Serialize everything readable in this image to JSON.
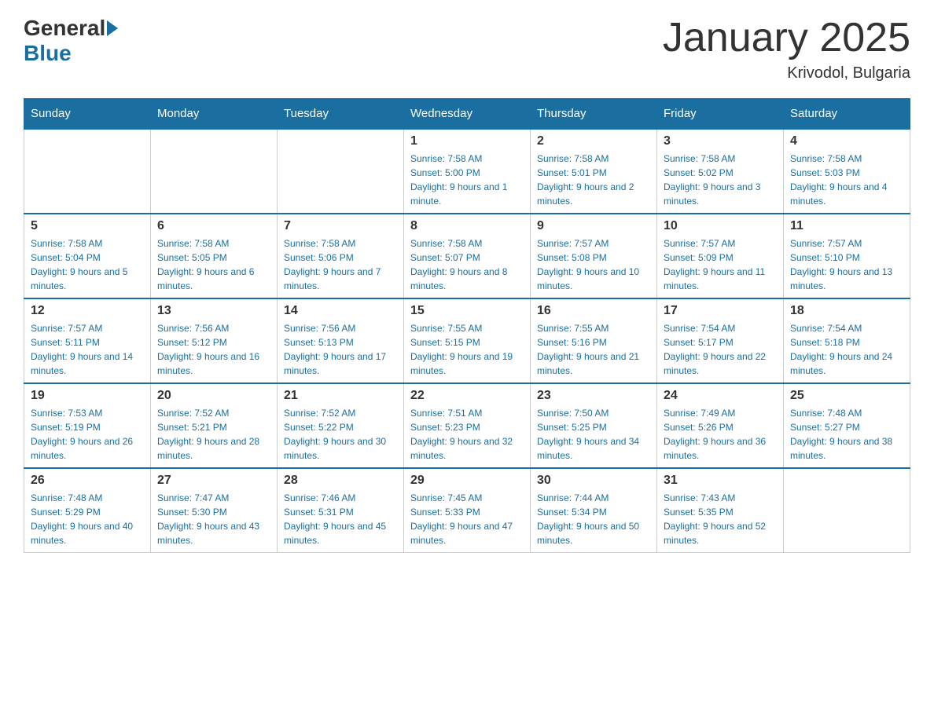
{
  "header": {
    "logo": {
      "general": "General",
      "blue": "Blue"
    },
    "title": "January 2025",
    "location": "Krivodol, Bulgaria"
  },
  "days_of_week": [
    "Sunday",
    "Monday",
    "Tuesday",
    "Wednesday",
    "Thursday",
    "Friday",
    "Saturday"
  ],
  "weeks": [
    [
      {
        "day": "",
        "info": ""
      },
      {
        "day": "",
        "info": ""
      },
      {
        "day": "",
        "info": ""
      },
      {
        "day": "1",
        "info": "Sunrise: 7:58 AM\nSunset: 5:00 PM\nDaylight: 9 hours and 1 minute."
      },
      {
        "day": "2",
        "info": "Sunrise: 7:58 AM\nSunset: 5:01 PM\nDaylight: 9 hours and 2 minutes."
      },
      {
        "day": "3",
        "info": "Sunrise: 7:58 AM\nSunset: 5:02 PM\nDaylight: 9 hours and 3 minutes."
      },
      {
        "day": "4",
        "info": "Sunrise: 7:58 AM\nSunset: 5:03 PM\nDaylight: 9 hours and 4 minutes."
      }
    ],
    [
      {
        "day": "5",
        "info": "Sunrise: 7:58 AM\nSunset: 5:04 PM\nDaylight: 9 hours and 5 minutes."
      },
      {
        "day": "6",
        "info": "Sunrise: 7:58 AM\nSunset: 5:05 PM\nDaylight: 9 hours and 6 minutes."
      },
      {
        "day": "7",
        "info": "Sunrise: 7:58 AM\nSunset: 5:06 PM\nDaylight: 9 hours and 7 minutes."
      },
      {
        "day": "8",
        "info": "Sunrise: 7:58 AM\nSunset: 5:07 PM\nDaylight: 9 hours and 8 minutes."
      },
      {
        "day": "9",
        "info": "Sunrise: 7:57 AM\nSunset: 5:08 PM\nDaylight: 9 hours and 10 minutes."
      },
      {
        "day": "10",
        "info": "Sunrise: 7:57 AM\nSunset: 5:09 PM\nDaylight: 9 hours and 11 minutes."
      },
      {
        "day": "11",
        "info": "Sunrise: 7:57 AM\nSunset: 5:10 PM\nDaylight: 9 hours and 13 minutes."
      }
    ],
    [
      {
        "day": "12",
        "info": "Sunrise: 7:57 AM\nSunset: 5:11 PM\nDaylight: 9 hours and 14 minutes."
      },
      {
        "day": "13",
        "info": "Sunrise: 7:56 AM\nSunset: 5:12 PM\nDaylight: 9 hours and 16 minutes."
      },
      {
        "day": "14",
        "info": "Sunrise: 7:56 AM\nSunset: 5:13 PM\nDaylight: 9 hours and 17 minutes."
      },
      {
        "day": "15",
        "info": "Sunrise: 7:55 AM\nSunset: 5:15 PM\nDaylight: 9 hours and 19 minutes."
      },
      {
        "day": "16",
        "info": "Sunrise: 7:55 AM\nSunset: 5:16 PM\nDaylight: 9 hours and 21 minutes."
      },
      {
        "day": "17",
        "info": "Sunrise: 7:54 AM\nSunset: 5:17 PM\nDaylight: 9 hours and 22 minutes."
      },
      {
        "day": "18",
        "info": "Sunrise: 7:54 AM\nSunset: 5:18 PM\nDaylight: 9 hours and 24 minutes."
      }
    ],
    [
      {
        "day": "19",
        "info": "Sunrise: 7:53 AM\nSunset: 5:19 PM\nDaylight: 9 hours and 26 minutes."
      },
      {
        "day": "20",
        "info": "Sunrise: 7:52 AM\nSunset: 5:21 PM\nDaylight: 9 hours and 28 minutes."
      },
      {
        "day": "21",
        "info": "Sunrise: 7:52 AM\nSunset: 5:22 PM\nDaylight: 9 hours and 30 minutes."
      },
      {
        "day": "22",
        "info": "Sunrise: 7:51 AM\nSunset: 5:23 PM\nDaylight: 9 hours and 32 minutes."
      },
      {
        "day": "23",
        "info": "Sunrise: 7:50 AM\nSunset: 5:25 PM\nDaylight: 9 hours and 34 minutes."
      },
      {
        "day": "24",
        "info": "Sunrise: 7:49 AM\nSunset: 5:26 PM\nDaylight: 9 hours and 36 minutes."
      },
      {
        "day": "25",
        "info": "Sunrise: 7:48 AM\nSunset: 5:27 PM\nDaylight: 9 hours and 38 minutes."
      }
    ],
    [
      {
        "day": "26",
        "info": "Sunrise: 7:48 AM\nSunset: 5:29 PM\nDaylight: 9 hours and 40 minutes."
      },
      {
        "day": "27",
        "info": "Sunrise: 7:47 AM\nSunset: 5:30 PM\nDaylight: 9 hours and 43 minutes."
      },
      {
        "day": "28",
        "info": "Sunrise: 7:46 AM\nSunset: 5:31 PM\nDaylight: 9 hours and 45 minutes."
      },
      {
        "day": "29",
        "info": "Sunrise: 7:45 AM\nSunset: 5:33 PM\nDaylight: 9 hours and 47 minutes."
      },
      {
        "day": "30",
        "info": "Sunrise: 7:44 AM\nSunset: 5:34 PM\nDaylight: 9 hours and 50 minutes."
      },
      {
        "day": "31",
        "info": "Sunrise: 7:43 AM\nSunset: 5:35 PM\nDaylight: 9 hours and 52 minutes."
      },
      {
        "day": "",
        "info": ""
      }
    ]
  ]
}
